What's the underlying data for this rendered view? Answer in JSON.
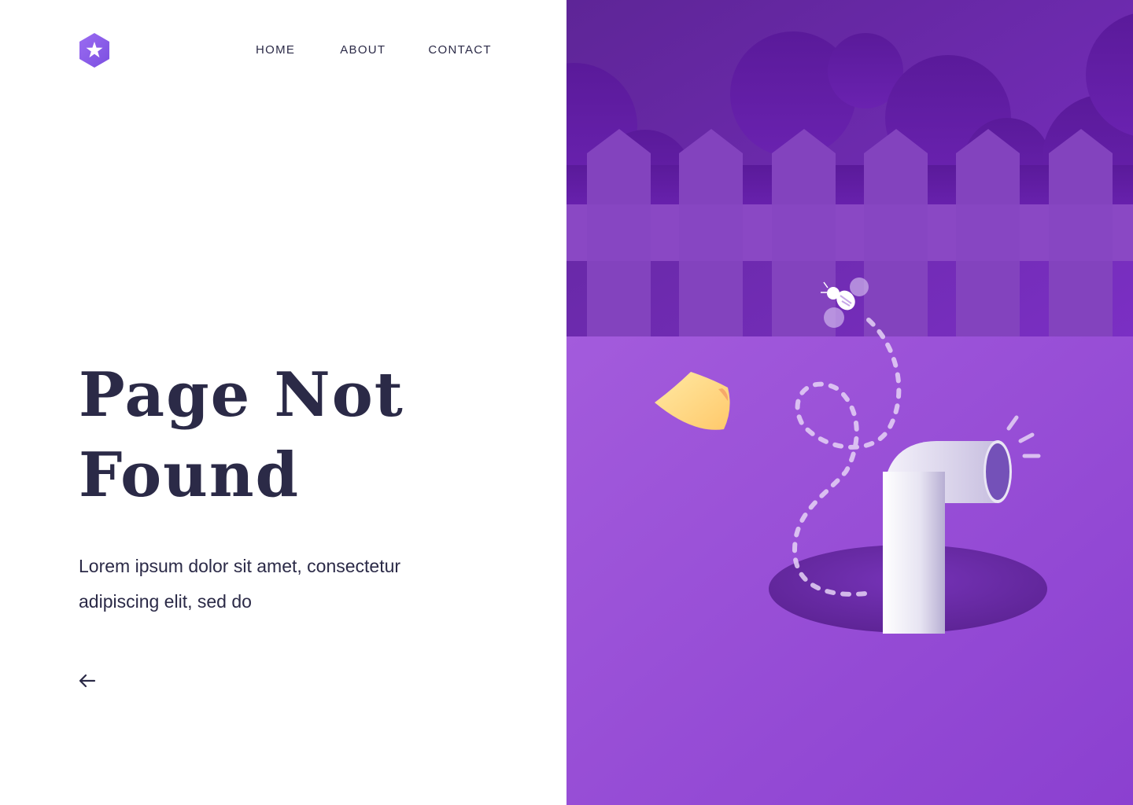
{
  "header": {
    "logo_icon": "star-hexagon-logo",
    "nav": [
      {
        "label": "HOME"
      },
      {
        "label": "ABOUT"
      },
      {
        "label": "CONTACT"
      }
    ]
  },
  "main": {
    "title_line1": "Page Not",
    "title_line2": "Found",
    "description": "Lorem ipsum dolor sit amet, consectetur adipiscing elit, sed do",
    "back_icon": "arrow-left-icon"
  },
  "illustration": {
    "subject": "bee flying out of periscope pipe in a hole, fence and trees background, sticky note",
    "colors": {
      "brand": "#8b5cf6",
      "sky": "#6a2ba7",
      "ground": "#9a4fd6",
      "note": "#ffd27a"
    }
  }
}
